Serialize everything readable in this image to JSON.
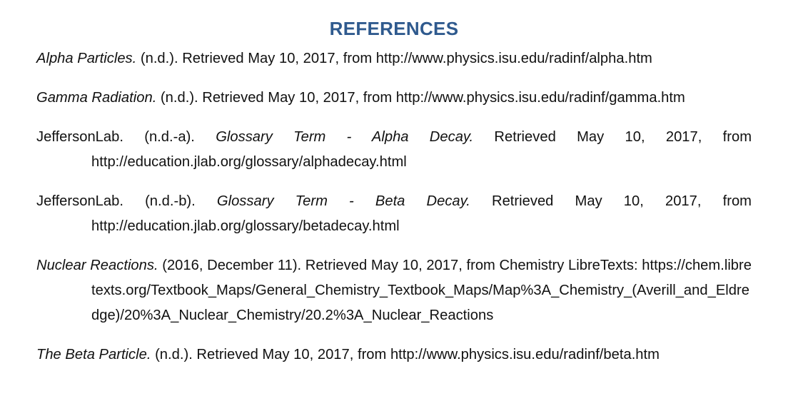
{
  "heading": "REFERENCES",
  "references": [
    {
      "pre": "",
      "title": "Alpha Particles.",
      "post": " (n.d.). Retrieved May 10, 2017, from http://www.physics.isu.edu/radinf/alpha.htm"
    },
    {
      "pre": "",
      "title": "Gamma Radiation.",
      "post": " (n.d.). Retrieved May 10, 2017, from http://www.physics.isu.edu/radinf/gamma.htm"
    },
    {
      "pre": "JeffersonLab. (n.d.-a). ",
      "title": "Glossary Term - Alpha Decay.",
      "post": " Retrieved May 10, 2017, from http://education.jlab.org/glossary/alphadecay.html"
    },
    {
      "pre": "JeffersonLab. (n.d.-b). ",
      "title": "Glossary Term - Beta Decay.",
      "post": " Retrieved May 10, 2017, from http://education.jlab.org/glossary/betadecay.html"
    },
    {
      "pre": "",
      "title": "Nuclear Reactions.",
      "post": " (2016, December 11). Retrieved May 10, 2017, from Chemistry LibreTexts: https://chem.libretexts.org/Textbook_Maps/General_Chemistry_Textbook_Maps/Map%3A_Chemistry_(Averill_and_Eldredge)/20%3A_Nuclear_Chemistry/20.2%3A_Nuclear_Reactions"
    },
    {
      "pre": "",
      "title": "The Beta Particle.",
      "post": " (n.d.). Retrieved May 10, 2017, from http://www.physics.isu.edu/radinf/beta.htm"
    }
  ]
}
